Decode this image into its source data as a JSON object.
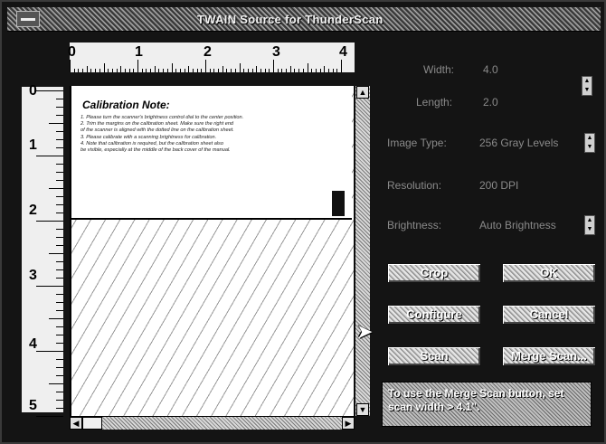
{
  "window": {
    "title": "TWAIN Source for ThunderScan"
  },
  "ruler": {
    "horizontal": [
      "0",
      "1",
      "2",
      "3",
      "4"
    ],
    "vertical": [
      "0",
      "1",
      "2",
      "3",
      "4",
      "5"
    ]
  },
  "note": {
    "title": "Calibration Note:",
    "lines": [
      "1. Please turn the scanner's brightness control dial to the center position.",
      "2. Trim the margins on the calibration sheet. Make sure the right end",
      "   of the scanner is aligned with the dotted line on the calibration sheet.",
      "3. Please calibrate with a scanning brightness for calibration.",
      "4. Note that calibration is required, but the calibration sheet also",
      "   be visible, especially at the middle of the back cover of the manual."
    ]
  },
  "settings": {
    "width_label": "Width:",
    "width_value": "4.0",
    "length_label": "Length:",
    "length_value": "2.0",
    "image_type_label": "Image Type:",
    "image_type_value": "256 Gray Levels",
    "resolution_label": "Resolution:",
    "resolution_value": "200 DPI",
    "brightness_label": "Brightness:",
    "brightness_value": "Auto Brightness"
  },
  "buttons": {
    "crop": "Crop",
    "ok": "OK",
    "configure": "Configure",
    "cancel": "Cancel",
    "scan": "Scan",
    "merge_scan": "Merge Scan..."
  },
  "hint": "To use the Merge Scan button, set scan width > 4.1\"."
}
